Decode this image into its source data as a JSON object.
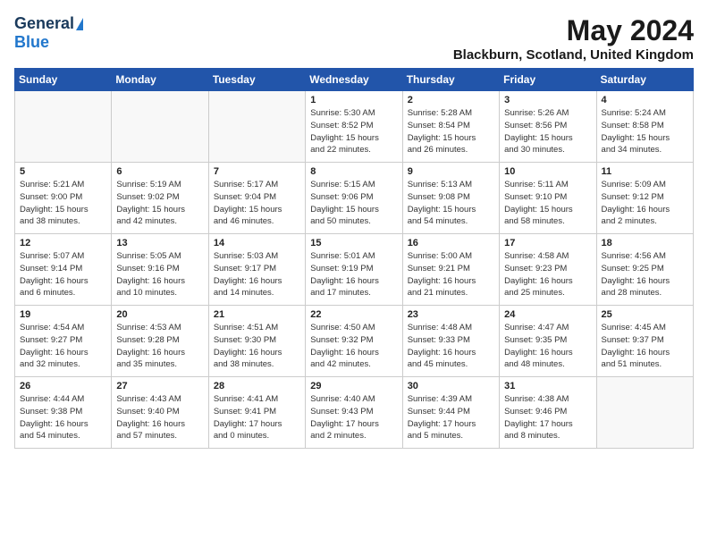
{
  "header": {
    "logo_general": "General",
    "logo_blue": "Blue",
    "title": "May 2024",
    "location": "Blackburn, Scotland, United Kingdom"
  },
  "days_of_week": [
    "Sunday",
    "Monday",
    "Tuesday",
    "Wednesday",
    "Thursday",
    "Friday",
    "Saturday"
  ],
  "weeks": [
    [
      {
        "day": "",
        "detail": ""
      },
      {
        "day": "",
        "detail": ""
      },
      {
        "day": "",
        "detail": ""
      },
      {
        "day": "1",
        "detail": "Sunrise: 5:30 AM\nSunset: 8:52 PM\nDaylight: 15 hours\nand 22 minutes."
      },
      {
        "day": "2",
        "detail": "Sunrise: 5:28 AM\nSunset: 8:54 PM\nDaylight: 15 hours\nand 26 minutes."
      },
      {
        "day": "3",
        "detail": "Sunrise: 5:26 AM\nSunset: 8:56 PM\nDaylight: 15 hours\nand 30 minutes."
      },
      {
        "day": "4",
        "detail": "Sunrise: 5:24 AM\nSunset: 8:58 PM\nDaylight: 15 hours\nand 34 minutes."
      }
    ],
    [
      {
        "day": "5",
        "detail": "Sunrise: 5:21 AM\nSunset: 9:00 PM\nDaylight: 15 hours\nand 38 minutes."
      },
      {
        "day": "6",
        "detail": "Sunrise: 5:19 AM\nSunset: 9:02 PM\nDaylight: 15 hours\nand 42 minutes."
      },
      {
        "day": "7",
        "detail": "Sunrise: 5:17 AM\nSunset: 9:04 PM\nDaylight: 15 hours\nand 46 minutes."
      },
      {
        "day": "8",
        "detail": "Sunrise: 5:15 AM\nSunset: 9:06 PM\nDaylight: 15 hours\nand 50 minutes."
      },
      {
        "day": "9",
        "detail": "Sunrise: 5:13 AM\nSunset: 9:08 PM\nDaylight: 15 hours\nand 54 minutes."
      },
      {
        "day": "10",
        "detail": "Sunrise: 5:11 AM\nSunset: 9:10 PM\nDaylight: 15 hours\nand 58 minutes."
      },
      {
        "day": "11",
        "detail": "Sunrise: 5:09 AM\nSunset: 9:12 PM\nDaylight: 16 hours\nand 2 minutes."
      }
    ],
    [
      {
        "day": "12",
        "detail": "Sunrise: 5:07 AM\nSunset: 9:14 PM\nDaylight: 16 hours\nand 6 minutes."
      },
      {
        "day": "13",
        "detail": "Sunrise: 5:05 AM\nSunset: 9:16 PM\nDaylight: 16 hours\nand 10 minutes."
      },
      {
        "day": "14",
        "detail": "Sunrise: 5:03 AM\nSunset: 9:17 PM\nDaylight: 16 hours\nand 14 minutes."
      },
      {
        "day": "15",
        "detail": "Sunrise: 5:01 AM\nSunset: 9:19 PM\nDaylight: 16 hours\nand 17 minutes."
      },
      {
        "day": "16",
        "detail": "Sunrise: 5:00 AM\nSunset: 9:21 PM\nDaylight: 16 hours\nand 21 minutes."
      },
      {
        "day": "17",
        "detail": "Sunrise: 4:58 AM\nSunset: 9:23 PM\nDaylight: 16 hours\nand 25 minutes."
      },
      {
        "day": "18",
        "detail": "Sunrise: 4:56 AM\nSunset: 9:25 PM\nDaylight: 16 hours\nand 28 minutes."
      }
    ],
    [
      {
        "day": "19",
        "detail": "Sunrise: 4:54 AM\nSunset: 9:27 PM\nDaylight: 16 hours\nand 32 minutes."
      },
      {
        "day": "20",
        "detail": "Sunrise: 4:53 AM\nSunset: 9:28 PM\nDaylight: 16 hours\nand 35 minutes."
      },
      {
        "day": "21",
        "detail": "Sunrise: 4:51 AM\nSunset: 9:30 PM\nDaylight: 16 hours\nand 38 minutes."
      },
      {
        "day": "22",
        "detail": "Sunrise: 4:50 AM\nSunset: 9:32 PM\nDaylight: 16 hours\nand 42 minutes."
      },
      {
        "day": "23",
        "detail": "Sunrise: 4:48 AM\nSunset: 9:33 PM\nDaylight: 16 hours\nand 45 minutes."
      },
      {
        "day": "24",
        "detail": "Sunrise: 4:47 AM\nSunset: 9:35 PM\nDaylight: 16 hours\nand 48 minutes."
      },
      {
        "day": "25",
        "detail": "Sunrise: 4:45 AM\nSunset: 9:37 PM\nDaylight: 16 hours\nand 51 minutes."
      }
    ],
    [
      {
        "day": "26",
        "detail": "Sunrise: 4:44 AM\nSunset: 9:38 PM\nDaylight: 16 hours\nand 54 minutes."
      },
      {
        "day": "27",
        "detail": "Sunrise: 4:43 AM\nSunset: 9:40 PM\nDaylight: 16 hours\nand 57 minutes."
      },
      {
        "day": "28",
        "detail": "Sunrise: 4:41 AM\nSunset: 9:41 PM\nDaylight: 17 hours\nand 0 minutes."
      },
      {
        "day": "29",
        "detail": "Sunrise: 4:40 AM\nSunset: 9:43 PM\nDaylight: 17 hours\nand 2 minutes."
      },
      {
        "day": "30",
        "detail": "Sunrise: 4:39 AM\nSunset: 9:44 PM\nDaylight: 17 hours\nand 5 minutes."
      },
      {
        "day": "31",
        "detail": "Sunrise: 4:38 AM\nSunset: 9:46 PM\nDaylight: 17 hours\nand 8 minutes."
      },
      {
        "day": "",
        "detail": ""
      }
    ]
  ]
}
